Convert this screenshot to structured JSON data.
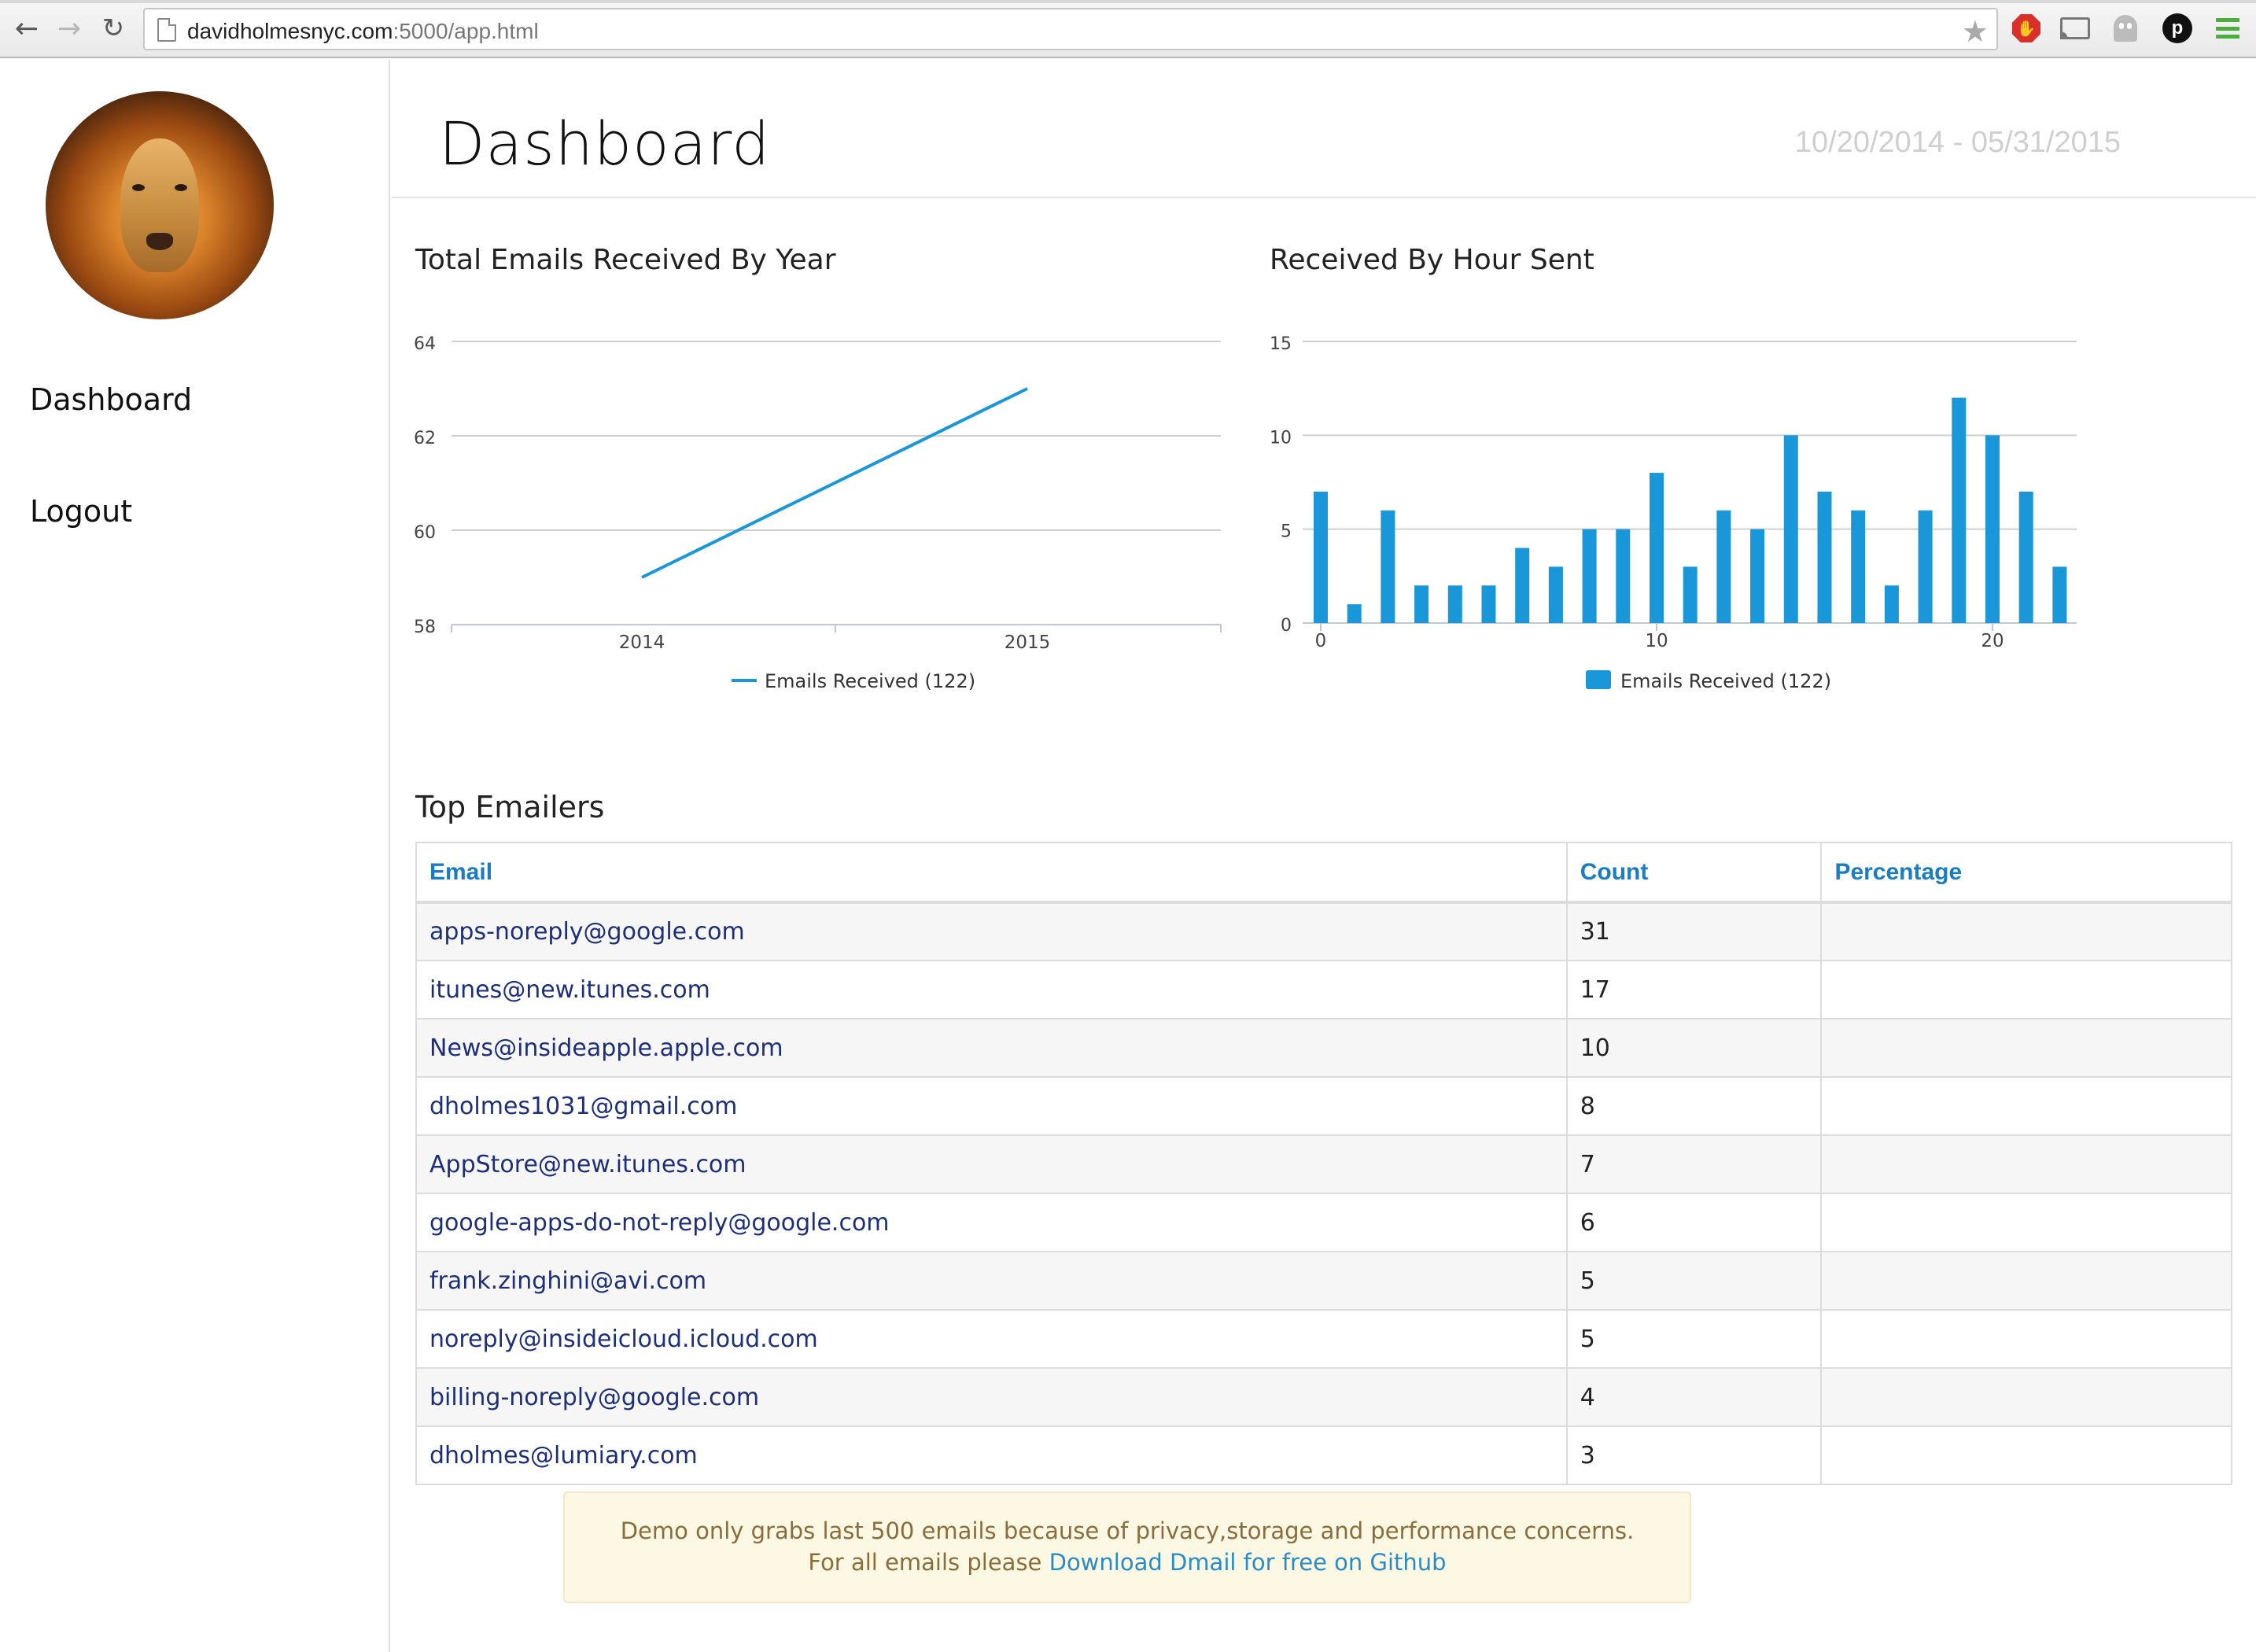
{
  "browser": {
    "url_host": "davidholmesnyc.com",
    "url_rest": ":5000/app.html"
  },
  "sidebar": {
    "items": [
      {
        "label": "Dashboard"
      },
      {
        "label": "Logout"
      }
    ]
  },
  "header": {
    "title": "Dashboard",
    "date_range": "10/20/2014 - 05/31/2015"
  },
  "charts": {
    "year_title": "Total Emails Received By Year",
    "hour_title": "Received By Hour Sent"
  },
  "chart_data": [
    {
      "type": "line",
      "title": "Total Emails Received By Year",
      "x": [
        2014,
        2015
      ],
      "xticks": [
        "2014",
        "2015"
      ],
      "series": [
        {
          "name": "Emails Received (122)",
          "values": [
            59,
            63
          ]
        }
      ],
      "ylim": [
        58,
        64
      ],
      "yticks": [
        58,
        60,
        62,
        64
      ],
      "grid": true,
      "legend": "bottom-center",
      "color": "#1a97d8"
    },
    {
      "type": "bar",
      "title": "Received By Hour Sent",
      "categories": [
        0,
        1,
        2,
        3,
        4,
        5,
        6,
        7,
        8,
        9,
        10,
        11,
        12,
        13,
        14,
        15,
        16,
        17,
        18,
        19,
        20,
        21,
        22
      ],
      "xticks": [
        "0",
        "10",
        "20"
      ],
      "series": [
        {
          "name": "Emails Received (122)",
          "values": [
            7,
            1,
            6,
            2,
            2,
            2,
            4,
            3,
            5,
            5,
            8,
            3,
            6,
            5,
            10,
            7,
            6,
            2,
            6,
            12,
            10,
            7,
            3
          ]
        }
      ],
      "ylim": [
        0,
        15
      ],
      "yticks": [
        0,
        5,
        10,
        15
      ],
      "grid": true,
      "legend": "bottom-center",
      "color": "#1a97d8"
    }
  ],
  "top_emailers": {
    "title": "Top Emailers",
    "columns": [
      "Email",
      "Count",
      "Percentage"
    ],
    "rows": [
      {
        "email": "apps-noreply@google.com",
        "count": "31",
        "percentage": ""
      },
      {
        "email": "itunes@new.itunes.com",
        "count": "17",
        "percentage": ""
      },
      {
        "email": "News@insideapple.apple.com",
        "count": "10",
        "percentage": ""
      },
      {
        "email": "dholmes1031@gmail.com",
        "count": "8",
        "percentage": ""
      },
      {
        "email": "AppStore@new.itunes.com",
        "count": "7",
        "percentage": ""
      },
      {
        "email": "google-apps-do-not-reply@google.com",
        "count": "6",
        "percentage": ""
      },
      {
        "email": "frank.zinghini@avi.com",
        "count": "5",
        "percentage": ""
      },
      {
        "email": "noreply@insideicloud.icloud.com",
        "count": "5",
        "percentage": ""
      },
      {
        "email": "billing-noreply@google.com",
        "count": "4",
        "percentage": ""
      },
      {
        "email": "dholmes@lumiary.com",
        "count": "3",
        "percentage": ""
      }
    ]
  },
  "notice": {
    "line1": "Demo only grabs last 500 emails because of privacy,storage and performance concerns.",
    "line2_prefix": "For all emails please ",
    "link_text": "Download Dmail for free on Github"
  },
  "icons": {
    "back": "back-arrow-icon",
    "forward": "forward-arrow-icon",
    "reload": "reload-icon",
    "page": "page-icon",
    "bookmark": "star-icon",
    "adblock": "adblock-icon",
    "cast": "cast-icon",
    "ghostery": "ghost-icon",
    "p_ext": "p-extension-icon",
    "menu": "hamburger-menu-icon"
  }
}
